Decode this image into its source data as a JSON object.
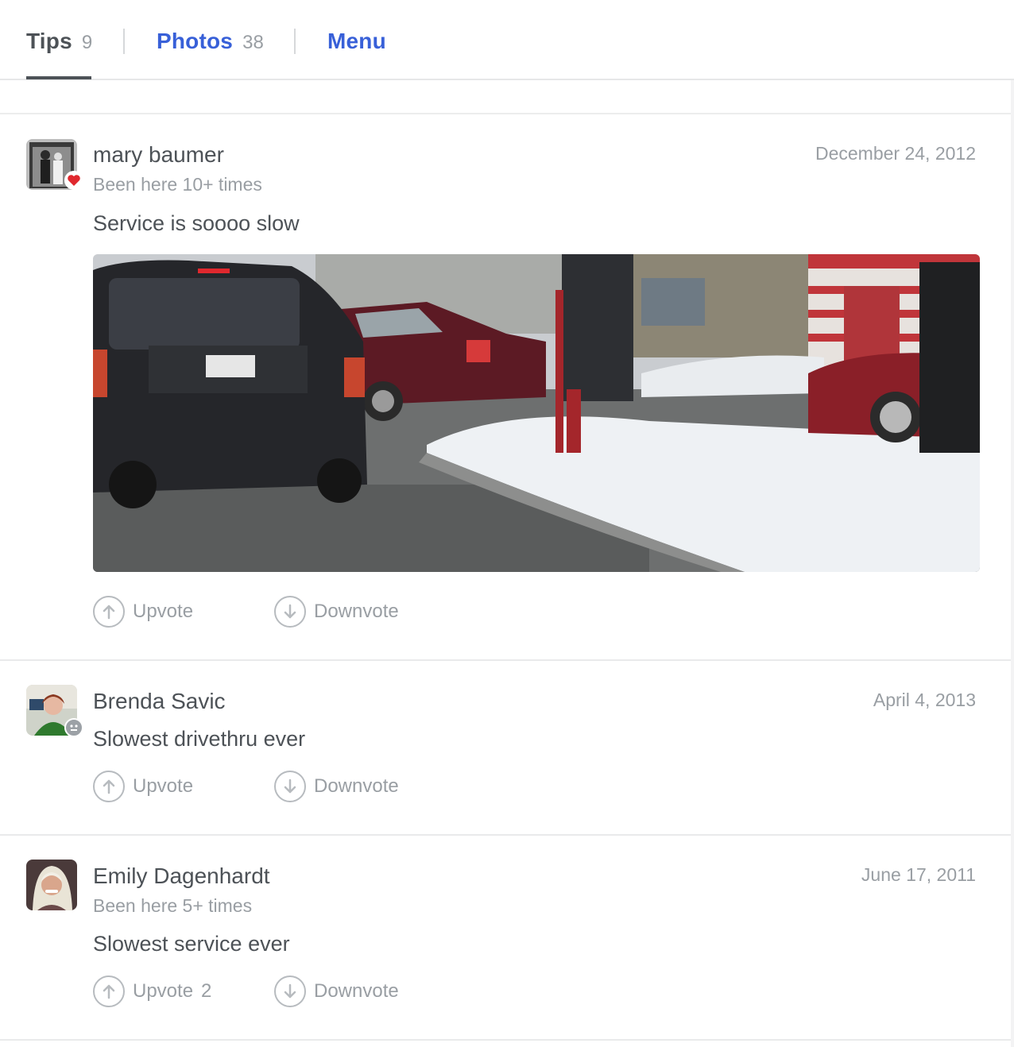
{
  "tabs": [
    {
      "label": "Tips",
      "count": "9",
      "active": true
    },
    {
      "label": "Photos",
      "count": "38",
      "active": false
    },
    {
      "label": "Menu",
      "count": "",
      "active": false
    }
  ],
  "tips": [
    {
      "author": "mary baumer",
      "visits": "Been here 10+ times",
      "date": "December 24, 2012",
      "text": "Service is soooo slow",
      "has_photo": true,
      "badge": "heart-icon",
      "upvote_label": "Upvote",
      "upvote_count": "",
      "downvote_label": "Downvote"
    },
    {
      "author": "Brenda Savic",
      "visits": "",
      "date": "April 4, 2013",
      "text": "Slowest drivethru ever",
      "has_photo": false,
      "badge": "neutral-face-icon",
      "upvote_label": "Upvote",
      "upvote_count": "",
      "downvote_label": "Downvote"
    },
    {
      "author": "Emily Dagenhardt",
      "visits": "Been here 5+ times",
      "date": "June 17, 2011",
      "text": "Slowest service ever",
      "has_photo": false,
      "badge": "",
      "upvote_label": "Upvote",
      "upvote_count": "2",
      "downvote_label": "Downvote"
    }
  ],
  "colors": {
    "accent": "#3860d8",
    "text": "#4d5257",
    "muted": "#999ea3",
    "heart": "#e0282e"
  }
}
